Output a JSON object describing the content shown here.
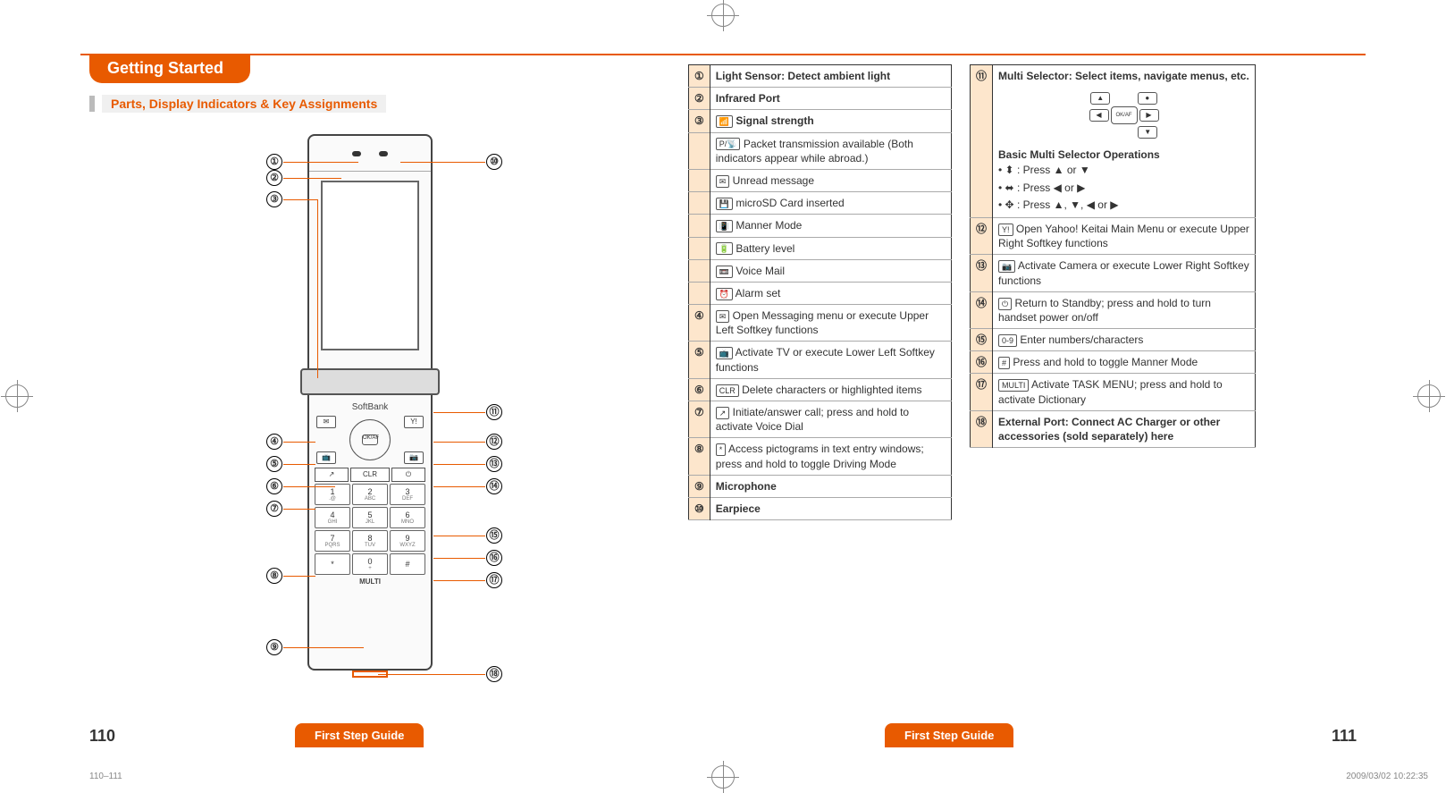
{
  "chapter": "Getting Started",
  "section": "Parts, Display Indicators & Key Assignments",
  "brand": "SoftBank",
  "dpad_center": "OK/AF",
  "keys": {
    "ul": "✉",
    "ur": "Y!",
    "ll": "📺",
    "lr": "📷",
    "call": "↗",
    "clr": "CLR",
    "end": "⏻"
  },
  "keypad": [
    {
      "main": "1",
      "sub": ".@"
    },
    {
      "main": "2",
      "sub": "ABC"
    },
    {
      "main": "3",
      "sub": "DEF"
    },
    {
      "main": "4",
      "sub": "GHI"
    },
    {
      "main": "5",
      "sub": "JKL"
    },
    {
      "main": "6",
      "sub": "MNO"
    },
    {
      "main": "7",
      "sub": "PQRS"
    },
    {
      "main": "8",
      "sub": "TUV"
    },
    {
      "main": "9",
      "sub": "WXYZ"
    },
    {
      "main": "*",
      "sub": ""
    },
    {
      "main": "0",
      "sub": "+"
    },
    {
      "main": "#",
      "sub": ""
    }
  ],
  "multi_key_label": "MULTI",
  "table1": {
    "rows": [
      {
        "n": "①",
        "icon": "",
        "text": "Light Sensor: Detect ambient light",
        "bold": true
      },
      {
        "n": "②",
        "icon": "",
        "text": "Infrared Port",
        "bold": true
      },
      {
        "n": "③",
        "icon": "📶",
        "text": "Signal strength",
        "bold": true
      },
      {
        "n": "",
        "icon": "P/📡",
        "text": "Packet transmission available (Both indicators appear while abroad.)"
      },
      {
        "n": "",
        "icon": "✉",
        "text": "Unread message"
      },
      {
        "n": "",
        "icon": "💾",
        "text": "microSD Card inserted"
      },
      {
        "n": "",
        "icon": "📳",
        "text": "Manner Mode"
      },
      {
        "n": "",
        "icon": "🔋",
        "text": "Battery level"
      },
      {
        "n": "",
        "icon": "📼",
        "text": "Voice Mail"
      },
      {
        "n": "",
        "icon": "⏰",
        "text": "Alarm set"
      },
      {
        "n": "④",
        "icon": "✉",
        "text": "Open Messaging menu or execute Upper Left Softkey functions"
      },
      {
        "n": "⑤",
        "icon": "📺",
        "text": "Activate TV or execute Lower Left Softkey functions"
      },
      {
        "n": "⑥",
        "icon": "CLR",
        "text": "Delete characters or highlighted items"
      },
      {
        "n": "⑦",
        "icon": "↗",
        "text": "Initiate/answer call; press and hold to activate Voice Dial"
      },
      {
        "n": "⑧",
        "icon": "*",
        "text": "Access pictograms in text entry windows; press and hold to toggle Driving Mode"
      },
      {
        "n": "⑨",
        "icon": "",
        "text": "Microphone",
        "bold": true
      },
      {
        "n": "⑩",
        "icon": "",
        "text": "Earpiece",
        "bold": true
      }
    ]
  },
  "table2": {
    "head": {
      "n": "⑪",
      "text": "Multi Selector: Select items, navigate menus, etc."
    },
    "ops_title": "Basic Multi Selector Operations",
    "ops": [
      "⬍ : Press ▲ or ▼",
      "⬌ : Press ◀ or ▶",
      "✥ : Press ▲, ▼, ◀ or ▶"
    ],
    "rows": [
      {
        "n": "⑫",
        "icon": "Y!",
        "text": "Open Yahoo! Keitai Main Menu or execute Upper Right Softkey functions"
      },
      {
        "n": "⑬",
        "icon": "📷",
        "text": "Activate Camera or execute Lower Right Softkey functions"
      },
      {
        "n": "⑭",
        "icon": "⏻",
        "text": "Return to Standby; press and hold to turn handset power on/off"
      },
      {
        "n": "⑮",
        "icon": "0-9",
        "text": "Enter numbers/characters"
      },
      {
        "n": "⑯",
        "icon": "#",
        "text": "Press and hold to toggle Manner Mode"
      },
      {
        "n": "⑰",
        "icon": "MULTI",
        "text": "Activate TASK MENU; press and hold to activate Dictionary"
      },
      {
        "n": "⑱",
        "icon": "",
        "text": "External Port: Connect AC Charger or other accessories (sold separately) here",
        "bold": true
      }
    ]
  },
  "footer": "First Step Guide",
  "page_left": "110",
  "page_right": "111",
  "meta_pages": "110–111",
  "meta_ts": "2009/03/02   10:22:35"
}
